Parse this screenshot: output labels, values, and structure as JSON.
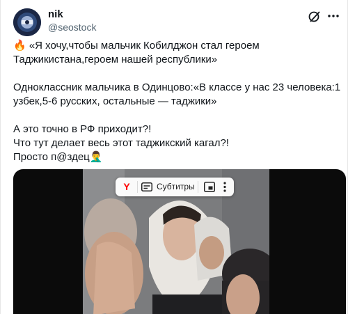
{
  "author": {
    "name": "nik",
    "handle": "@seostock"
  },
  "post": {
    "paragraphs": [
      [
        "🔥 «Я хочу,чтобы мальчик Кобилджон стал героем",
        "Таджикистана,героем нашей республики»"
      ],
      [
        "Одноклассник мальчика  в Одинцово:«В классе у нас 23 человека:1",
        "узбек,5-6 русских, остальные — таджики»"
      ],
      [
        "А это точно в РФ приходит?!",
        "Что тут делает весь этот таджикский кагал?!",
        "Просто п@здец🤦‍♂️"
      ]
    ]
  },
  "video_overlay": {
    "yandex_logo": "Y",
    "subtitles_label": "Субтитры"
  },
  "icons": {
    "grok": "grok-icon",
    "more": "more-icon",
    "subtitles": "subtitles-icon",
    "pip": "picture-in-picture-icon",
    "overlay_more": "vertical-dots-icon"
  },
  "colors": {
    "text": "#0f1419",
    "secondary": "#536471",
    "yandex_red": "#ff0000"
  }
}
